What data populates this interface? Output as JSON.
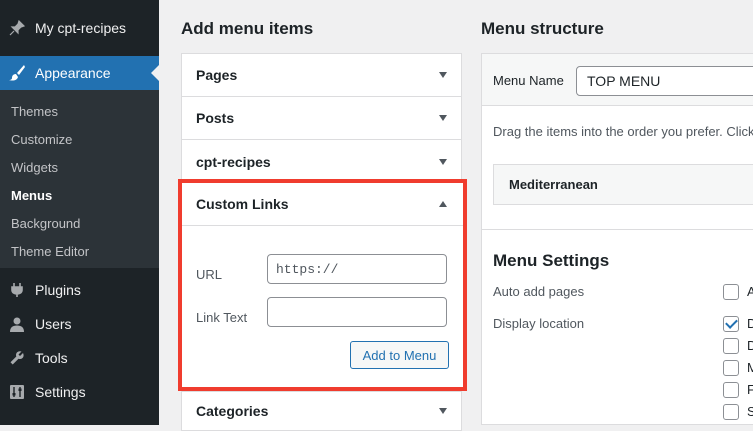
{
  "sidebar": {
    "top_item": "My cpt-recipes",
    "appearance": "Appearance",
    "submenu": [
      "Themes",
      "Customize",
      "Widgets",
      "Menus",
      "Background",
      "Theme Editor"
    ],
    "plugins": "Plugins",
    "users": "Users",
    "tools": "Tools",
    "settings": "Settings"
  },
  "add_items": {
    "title": "Add menu items",
    "sections": [
      "Pages",
      "Posts",
      "cpt-recipes"
    ],
    "custom_links": {
      "title": "Custom Links",
      "url_label": "URL",
      "url_placeholder": "https://",
      "link_text_label": "Link Text",
      "link_text_value": "",
      "button": "Add to Menu"
    },
    "categories": "Categories"
  },
  "structure": {
    "title": "Menu structure",
    "menu_name_label": "Menu Name",
    "menu_name_value": "TOP MENU",
    "instructions": "Drag the items into the order you prefer. Click",
    "menu_item": "Mediterranean",
    "settings_title": "Menu Settings",
    "auto_add_label": "Auto add pages",
    "display_location_label": "Display location",
    "checkbox_letters": [
      "A",
      "D",
      "D",
      "M",
      "F",
      "S"
    ],
    "checkbox_checked": [
      false,
      true,
      false,
      false,
      false,
      false
    ]
  },
  "colors": {
    "sidebar_bg": "#1d2327",
    "accent": "#2271b1",
    "highlight": "#f03c2e"
  }
}
